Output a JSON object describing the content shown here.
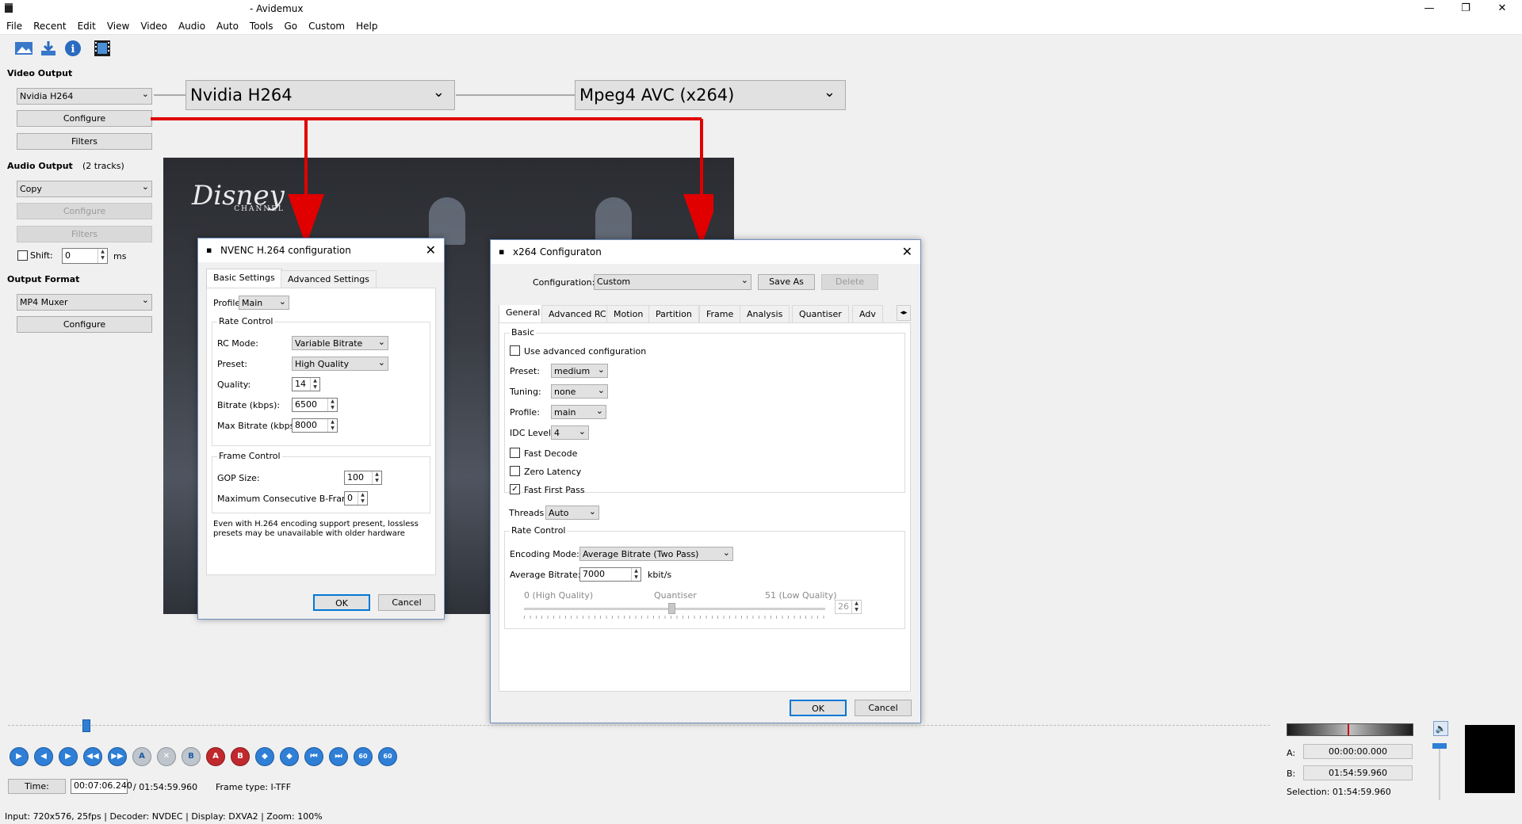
{
  "window": {
    "title": "- Avidemux",
    "app_icon": "clapperboard-icon"
  },
  "menu": [
    "File",
    "Recent",
    "Edit",
    "View",
    "Video",
    "Audio",
    "Auto",
    "Tools",
    "Go",
    "Custom",
    "Help"
  ],
  "toolbar": [
    "open-image-icon",
    "save-icon",
    "info-icon",
    "film-icon"
  ],
  "left": {
    "video_output_title": "Video Output",
    "video_codec": "Nvidia H264",
    "configure": "Configure",
    "filters": "Filters",
    "audio_output_title": "Audio Output",
    "audio_tracks": "(2 tracks)",
    "audio_codec": "Copy",
    "audio_configure": "Configure",
    "audio_filters": "Filters",
    "shift_label": "Shift:",
    "shift_value": "0",
    "shift_unit": "ms",
    "output_format_title": "Output Format",
    "muxer": "MP4 Muxer",
    "muxer_configure": "Configure"
  },
  "callouts": {
    "nvidia": "Nvidia H264",
    "x264": "Mpeg4 AVC (x264)"
  },
  "nvenc": {
    "title": "NVENC H.264 configuration",
    "tabs": [
      "Basic Settings",
      "Advanced Settings"
    ],
    "profile_label": "Profile:",
    "profile": "Main",
    "rate_control": "Rate Control",
    "rc_mode_label": "RC Mode:",
    "rc_mode": "Variable Bitrate",
    "preset_label": "Preset:",
    "preset": "High Quality",
    "quality_label": "Quality:",
    "quality": "14",
    "bitrate_label": "Bitrate (kbps):",
    "bitrate": "6500",
    "maxbitrate_label": "Max Bitrate (kbps):",
    "maxbitrate": "8000",
    "frame_control": "Frame Control",
    "gop_label": "GOP Size:",
    "gop": "100",
    "bframes_label": "Maximum Consecutive B-Frames:",
    "bframes": "0",
    "note1": "Even with H.264 encoding support present, lossless",
    "note2": "presets may be unavailable with older hardware",
    "ok": "OK",
    "cancel": "Cancel"
  },
  "x264": {
    "title": "x264 Configuraton",
    "config_label": "Configuration:",
    "config": "Custom",
    "save_as": "Save As",
    "delete": "Delete",
    "tabs": [
      "General",
      "Advanced RC",
      "Motion",
      "Partition",
      "Frame",
      "Analysis",
      "Quantiser",
      "Adv"
    ],
    "basic": "Basic",
    "use_advanced": "Use advanced configuration",
    "preset_label": "Preset:",
    "preset": "medium",
    "tuning_label": "Tuning:",
    "tuning": "none",
    "profile_label": "Profile:",
    "profile": "main",
    "idc_label": "IDC Level:",
    "idc": "4",
    "fast_decode": "Fast Decode",
    "zero_latency": "Zero Latency",
    "fast_first_pass": "Fast First Pass",
    "threads_label": "Threads",
    "threads": "Auto",
    "rate_control": "Rate Control",
    "enc_mode_label": "Encoding Mode:",
    "enc_mode": "Average Bitrate (Two Pass)",
    "avg_bitrate_label": "Average Bitrate:",
    "avg_bitrate": "7000",
    "avg_bitrate_unit": "kbit/s",
    "q_low": "0 (High Quality)",
    "q_mid": "Quantiser",
    "q_high": "51 (Low Quality)",
    "q_value": "26",
    "ok": "OK",
    "cancel": "Cancel"
  },
  "playback": {
    "time_label": "Time:",
    "time": "00:07:06.240",
    "duration": "/ 01:54:59.960",
    "frame_type": "Frame type:  I-TFF",
    "a_label": "A:",
    "a_value": "00:00:00.000",
    "b_label": "B:",
    "b_value": "01:54:59.960",
    "selection": "Selection: 01:54:59.960",
    "position": 0.062
  },
  "status": "Input: 720x576, 25fps  |  Decoder: NVDEC  |  Display: DXVA2  |  Zoom: 100%"
}
